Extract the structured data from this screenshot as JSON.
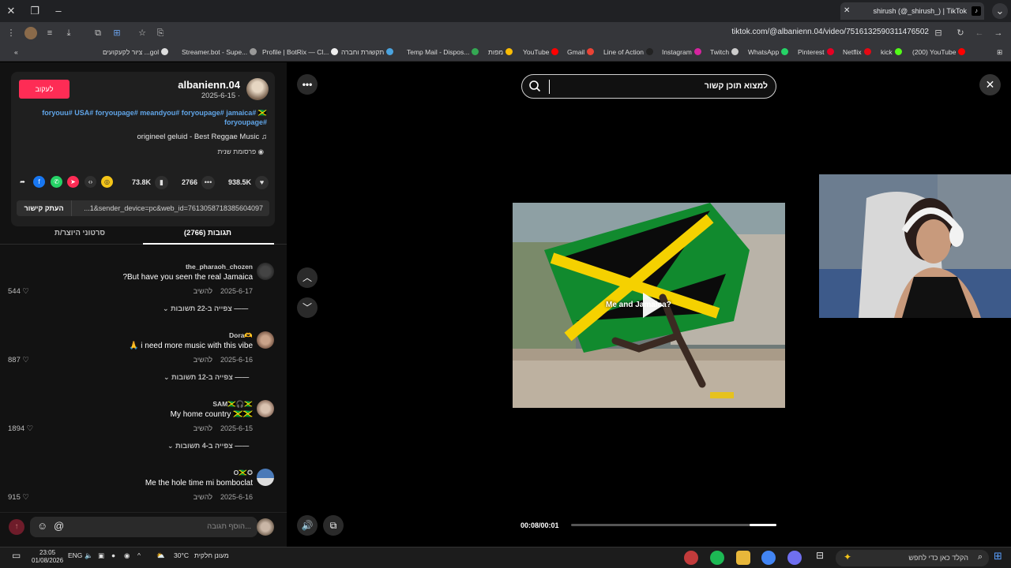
{
  "browser": {
    "tab_title": "shirush (@_shirush_) | TikTok",
    "url": "tiktok.com/@albanienn.04/video/7516132590311476502",
    "bookmarks": [
      "ציור לקעקועים ...gol",
      "Streamer.bot - Supe...",
      "Profile | BotRix — Cl...",
      "תקשורת וחברה",
      "Temp Mail - Dispos...",
      "מפות",
      "YouTube",
      "Gmail",
      "Line of Action",
      "Instagram",
      "Twitch",
      "WhatsApp",
      "Pinterest",
      "Netflix",
      "kick",
      "(200) YouTube"
    ]
  },
  "post": {
    "author": "albanienn.04",
    "date": "2025-6-15 · ",
    "follow_label": "לעקוב",
    "hashtags": "foryouu# USA# foryoupage# meandyou# foryoupage# jamaica# 🇯🇲 foryoupage#",
    "music": "origineel geluid - Best Reggae Music",
    "sponsor": "פרסומת שנית",
    "likes": "938.5K",
    "comments": "2766",
    "saves": "73.8K",
    "link": "...1&sender_device=pc&web_id=7613058718385604097",
    "copy_link": "העתק קישור"
  },
  "tabs": {
    "comments": "תגובות (2766)",
    "creator_videos": "סרטוני היוצר/ת"
  },
  "comments": [
    {
      "user": "the_pharaoh_chozen",
      "text": "?But have you seen the real Jamaica",
      "date": "2025-6-17",
      "reply": "להשיב",
      "likes": "544",
      "more": "צפייה ב-22 תשובות"
    },
    {
      "user": "Dora🫶",
      "text": "🙏 i need more music with this vibe",
      "date": "2025-6-16",
      "reply": "להשיב",
      "likes": "887",
      "more": "צפייה ב-12 תשובות"
    },
    {
      "user": "SAM🇯🇲🎧🇯🇲",
      "text": "My home country 🇯🇲🇯🇲",
      "date": "2025-6-15",
      "reply": "להשיב",
      "likes": "1894",
      "more": "צפייה ב-4 תשובות"
    },
    {
      "user": "O🇯🇲✪",
      "text": "Me the hole time mi bomboclat",
      "date": "2025-6-16",
      "reply": "להשיב",
      "likes": "915",
      "more": ""
    }
  ],
  "input": {
    "placeholder": "הוסף תגובה..."
  },
  "player": {
    "search_placeholder": "למצוא תוכן קשור",
    "caption": "Me and Jamaica?",
    "time": "00:08/00:01",
    "progress": 0.13
  },
  "taskbar": {
    "time": "23:05",
    "date": "01/08/2026",
    "lang": "ENG",
    "weather": "30°C",
    "weather_desc": "מעונן חלקית",
    "search_placeholder": "הקלד כאן כדי לחפש"
  },
  "colors": {
    "accent": "#fe2c55",
    "hashtag": "#60a5e8"
  }
}
